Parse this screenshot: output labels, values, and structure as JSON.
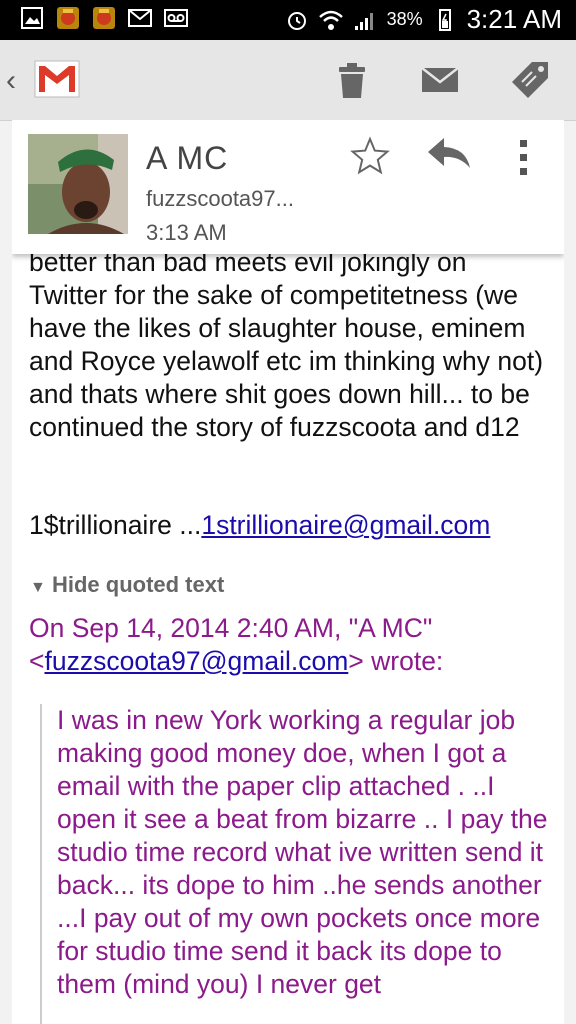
{
  "status_bar": {
    "battery_percent": "38%",
    "time": "3:21 AM",
    "icons": [
      "gallery-icon",
      "clash-of-clans-icon",
      "clash-of-clans-icon",
      "mail-notification-icon",
      "voicemail-icon",
      "alarm-icon",
      "wifi-icon",
      "signal-icon",
      "battery-icon"
    ]
  },
  "action_bar": {
    "app": "Gmail",
    "actions": [
      "delete",
      "mark-unread",
      "label"
    ]
  },
  "message": {
    "sender_name": "A MC",
    "sender_email": "fuzzscoota97...",
    "time": "3:13 AM",
    "body": "better than bad meets evil jokingly on Twitter for the sake of competitetness (we have the likes of slaughter house, eminem and Royce yelawolf etc im thinking why not) and thats where shit goes down hill... to be continued the story of fuzzscoota and d12",
    "signature_text": "1$trillionaire ...",
    "signature_link": "1strillionaire@gmail.com",
    "hide_quoted_label": "Hide quoted text",
    "quote_header_prefix": "On Sep 14, 2014 2:40 AM, \"A MC\" <",
    "quote_header_email": "fuzzscoota97@gmail.com",
    "quote_header_suffix": "> wrote:",
    "quoted_body": "I was in new York working a regular job making good money doe,  when I got a email with the paper clip attached . ..I open it see a beat from bizarre .. I pay the studio time record what ive written send it back... its dope to him ..he sends another ...I pay out of my own pockets once more for studio time send it back its dope to them (mind you) I never get"
  },
  "colors": {
    "quoted_text": "#8b1a8b",
    "link": "#1a0dab",
    "action_bar": "#e6e6e6"
  }
}
